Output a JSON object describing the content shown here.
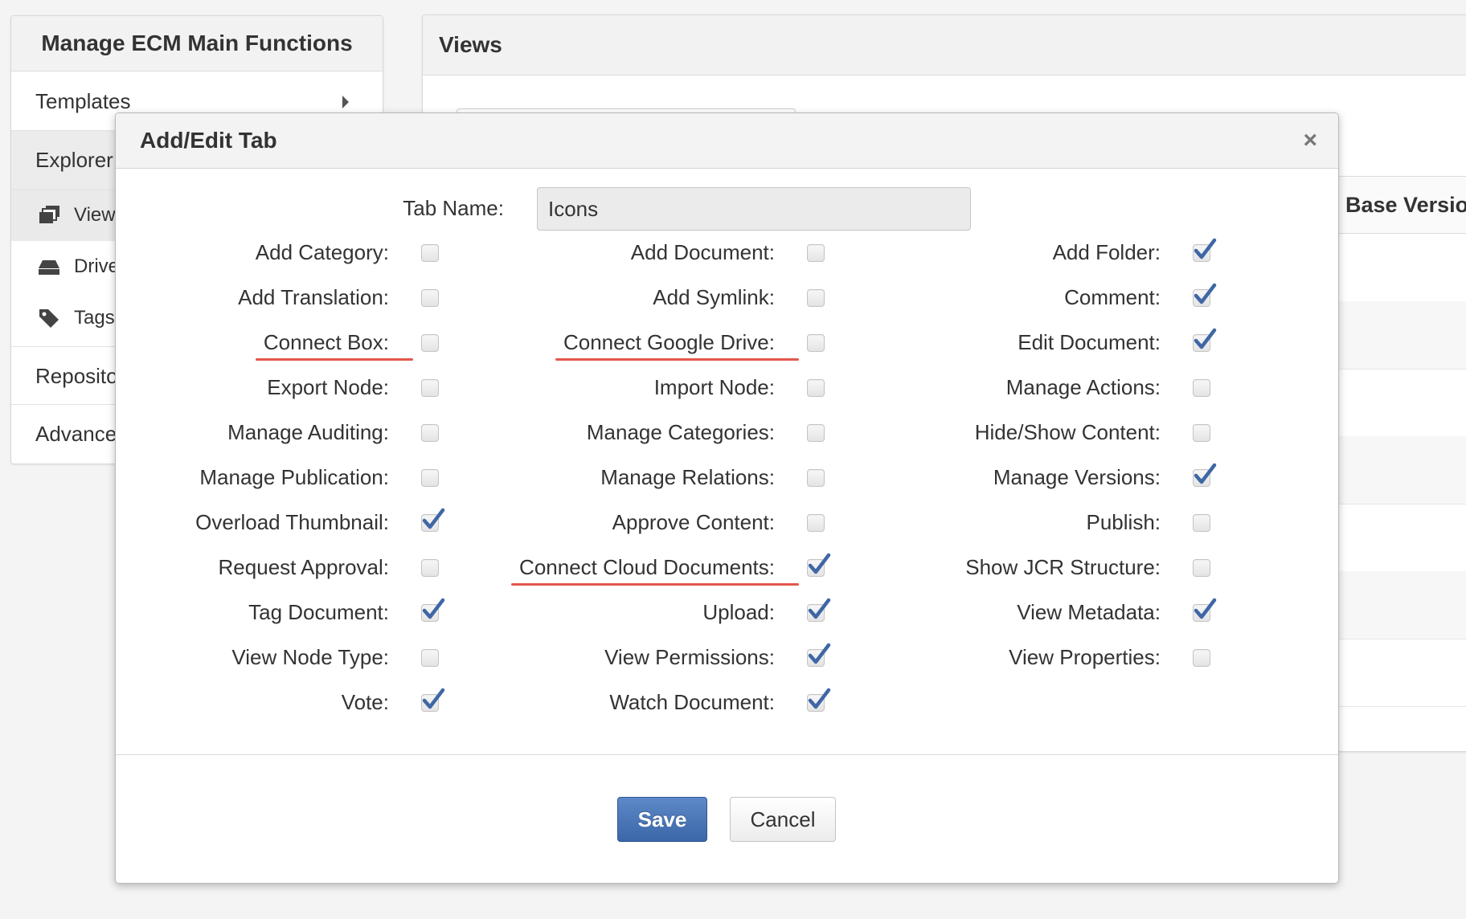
{
  "left_panel": {
    "title": "Manage ECM Main Functions",
    "items": [
      {
        "label": "Templates"
      },
      {
        "label": "Explorer"
      },
      {
        "label": "Repository"
      },
      {
        "label": "Advanced"
      }
    ],
    "sub_items": [
      {
        "label": "Views",
        "icon": "views-icon"
      },
      {
        "label": "Drives",
        "icon": "drive-icon"
      },
      {
        "label": "Tags",
        "icon": "tag-icon"
      }
    ]
  },
  "views_panel": {
    "title": "Views",
    "column_header": "Base Version"
  },
  "modal": {
    "title": "Add/Edit Tab",
    "close_glyph": "×",
    "tab_name_label": "Tab Name:",
    "tab_name_value": "Icons",
    "save_label": "Save",
    "cancel_label": "Cancel",
    "columns": [
      [
        {
          "label": "Add Category:",
          "checked": false
        },
        {
          "label": "Add Translation:",
          "checked": false
        },
        {
          "label": "Connect Box:",
          "checked": false,
          "highlighted": true
        },
        {
          "label": "Export Node:",
          "checked": false
        },
        {
          "label": "Manage Auditing:",
          "checked": false
        },
        {
          "label": "Manage Publication:",
          "checked": false
        },
        {
          "label": "Overload Thumbnail:",
          "checked": true
        },
        {
          "label": "Request Approval:",
          "checked": false
        },
        {
          "label": "Tag Document:",
          "checked": true
        },
        {
          "label": "View Node Type:",
          "checked": false
        },
        {
          "label": "Vote:",
          "checked": true
        }
      ],
      [
        {
          "label": "Add Document:",
          "checked": false
        },
        {
          "label": "Add Symlink:",
          "checked": false
        },
        {
          "label": "Connect Google Drive:",
          "checked": false,
          "highlighted": true
        },
        {
          "label": "Import Node:",
          "checked": false
        },
        {
          "label": "Manage Categories:",
          "checked": false
        },
        {
          "label": "Manage Relations:",
          "checked": false
        },
        {
          "label": "Approve Content:",
          "checked": false
        },
        {
          "label": "Connect Cloud Documents:",
          "checked": true,
          "highlighted": true
        },
        {
          "label": "Upload:",
          "checked": true
        },
        {
          "label": "View Permissions:",
          "checked": true
        },
        {
          "label": "Watch Document:",
          "checked": true
        }
      ],
      [
        {
          "label": "Add Folder:",
          "checked": true
        },
        {
          "label": "Comment:",
          "checked": true
        },
        {
          "label": "Edit Document:",
          "checked": true
        },
        {
          "label": "Manage Actions:",
          "checked": false
        },
        {
          "label": "Hide/Show Content:",
          "checked": false
        },
        {
          "label": "Manage Versions:",
          "checked": true
        },
        {
          "label": "Publish:",
          "checked": false
        },
        {
          "label": "Show JCR Structure:",
          "checked": false
        },
        {
          "label": "View Metadata:",
          "checked": true
        },
        {
          "label": "View Properties:",
          "checked": false
        }
      ]
    ]
  },
  "colors": {
    "primary_button": "#4a77b8",
    "checkmark": "#3f67a5",
    "highlight_underline": "#e3574b"
  }
}
